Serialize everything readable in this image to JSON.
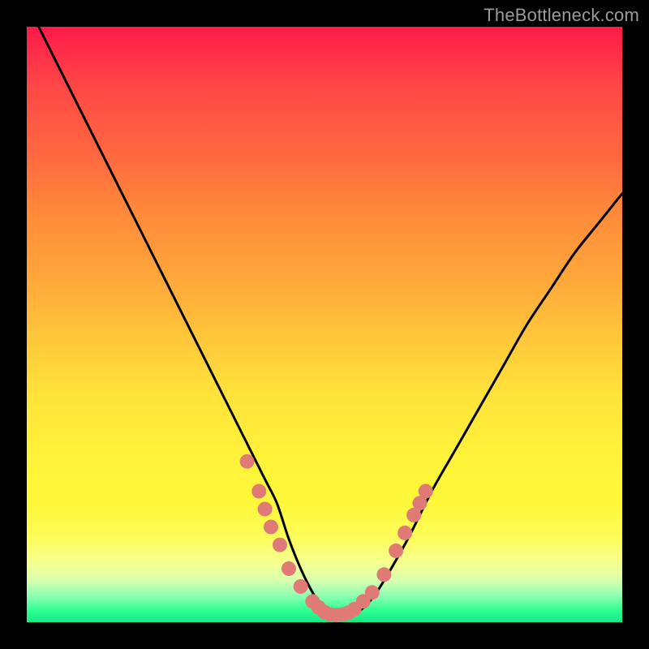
{
  "watermark": {
    "text": "TheBottleneck.com"
  },
  "chart_data": {
    "type": "line",
    "title": "",
    "xlabel": "",
    "ylabel": "",
    "xlim": [
      0,
      100
    ],
    "ylim": [
      0,
      100
    ],
    "grid": false,
    "legend": false,
    "series": [
      {
        "name": "bottleneck-curve",
        "x": [
          2,
          5,
          8,
          12,
          16,
          20,
          24,
          28,
          32,
          36,
          40,
          42,
          44,
          46,
          48,
          50,
          52,
          54,
          56,
          58,
          60,
          64,
          68,
          72,
          76,
          80,
          84,
          88,
          92,
          96,
          100
        ],
        "y": [
          100,
          94,
          88,
          80,
          72,
          64,
          56,
          48,
          40,
          32,
          24,
          20,
          14,
          9,
          5,
          2,
          1,
          1,
          2,
          4,
          7,
          14,
          22,
          29,
          36,
          43,
          50,
          56,
          62,
          67,
          72
        ]
      }
    ],
    "markers": [
      {
        "name": "dot-cluster",
        "color": "#e07a77",
        "points": [
          {
            "x": 37,
            "y": 27
          },
          {
            "x": 39,
            "y": 22
          },
          {
            "x": 40,
            "y": 19
          },
          {
            "x": 41,
            "y": 16
          },
          {
            "x": 42.5,
            "y": 13
          },
          {
            "x": 44,
            "y": 9
          },
          {
            "x": 46,
            "y": 6
          },
          {
            "x": 48,
            "y": 3.5
          },
          {
            "x": 49,
            "y": 2.5
          },
          {
            "x": 50,
            "y": 1.7
          },
          {
            "x": 51,
            "y": 1.3
          },
          {
            "x": 52,
            "y": 1.2
          },
          {
            "x": 53,
            "y": 1.3
          },
          {
            "x": 54,
            "y": 1.6
          },
          {
            "x": 55,
            "y": 2.2
          },
          {
            "x": 56.5,
            "y": 3.5
          },
          {
            "x": 58,
            "y": 5
          },
          {
            "x": 60,
            "y": 8
          },
          {
            "x": 62,
            "y": 12
          },
          {
            "x": 63.5,
            "y": 15
          },
          {
            "x": 65,
            "y": 18
          },
          {
            "x": 66,
            "y": 20
          },
          {
            "x": 67,
            "y": 22
          }
        ]
      }
    ]
  }
}
